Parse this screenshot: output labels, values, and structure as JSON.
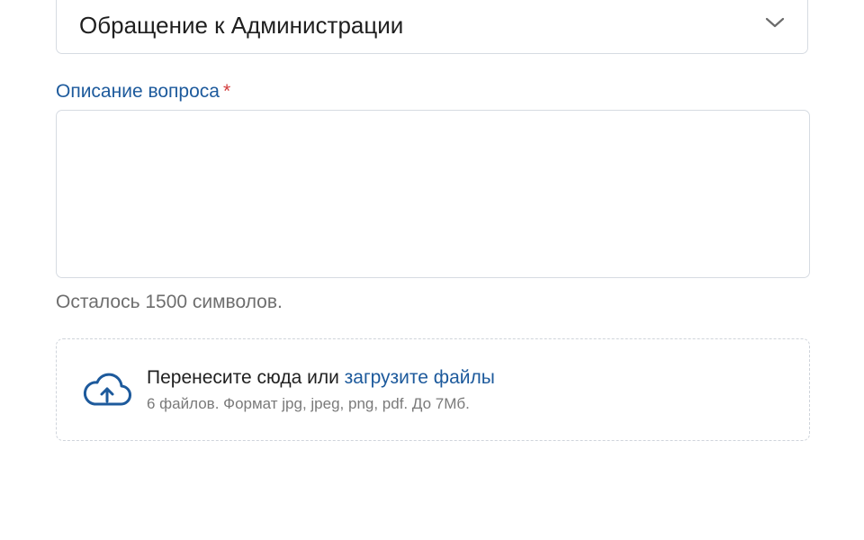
{
  "form": {
    "category_select": {
      "value": "Обращение к Администрации",
      "icon": "chevron-down-icon"
    },
    "description": {
      "label": "Описание вопроса",
      "required_mark": "*",
      "value": "",
      "counter_text": "Осталось 1500 символов."
    },
    "upload": {
      "prompt_text": "Перенесите сюда или ",
      "link_text": "загрузите файлы",
      "hint": "6 файлов. Формат jpg, jpeg, png, pdf. До 7Мб.",
      "icon": "cloud-upload-icon"
    }
  },
  "colors": {
    "accent": "#1d5a9c",
    "required": "#d23b3b",
    "border": "#d6dbe2",
    "muted_text": "#6e6e6e"
  }
}
